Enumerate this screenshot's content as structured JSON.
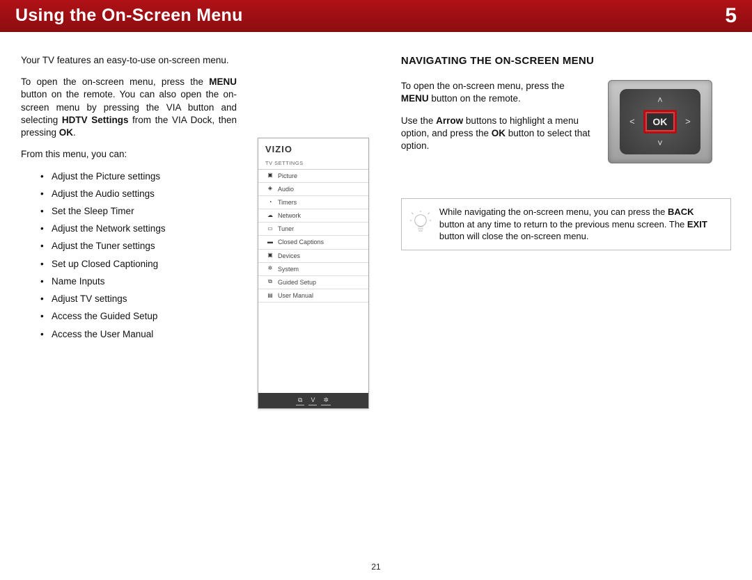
{
  "header": {
    "title": "Using the On-Screen Menu",
    "chapter": "5"
  },
  "left": {
    "intro": "Your TV features an easy-to-use on-screen menu.",
    "open_1": "To open the on-screen menu, press the ",
    "open_b1": "MENU",
    "open_2": " button on the remote. You can also open the on-screen menu by pressing the VIA button and selecting ",
    "open_b2": "HDTV Settings",
    "open_3": " from the VIA Dock, then pressing ",
    "open_b3": "OK",
    "open_4": ".",
    "from": "From this menu, you can:",
    "items": [
      "Adjust the Picture settings",
      "Adjust the Audio settings",
      "Set the Sleep Timer",
      "Adjust the Network settings",
      "Adjust the Tuner settings",
      "Set up Closed Captioning",
      "Name Inputs",
      "Adjust TV settings",
      "Access the Guided Setup",
      "Access the User Manual"
    ]
  },
  "panel": {
    "logo": "VIZIO",
    "section": "TV SETTINGS",
    "rows": [
      "Picture",
      "Audio",
      "Timers",
      "Network",
      "Tuner",
      "Closed Captions",
      "Devices",
      "System",
      "Guided Setup",
      "User Manual"
    ],
    "footer": {
      "a": "⧉",
      "b": "V",
      "c": "✲"
    }
  },
  "right": {
    "heading": "NAVIGATING THE ON-SCREEN MENU",
    "p1a": "To open the on-screen menu, press the ",
    "p1b": "MENU",
    "p1c": " button on the remote.",
    "p2a": "Use the ",
    "p2b": "Arrow",
    "p2c": " buttons to highlight a menu option, and press the ",
    "p2d": "OK",
    "p2e": " button to select that option.",
    "ok": "OK",
    "tip_a": "While navigating the on-screen menu, you can press the ",
    "tip_b1": "BACK",
    "tip_b": " button at any time to return to the previous menu screen. The ",
    "tip_b2": "EXIT",
    "tip_c": " button will close the on-screen menu."
  },
  "page": "21",
  "icons": [
    "▣",
    "◈",
    "◔",
    "☁",
    "▭",
    "▬",
    "▣",
    "✲",
    "⧉",
    "▤"
  ]
}
